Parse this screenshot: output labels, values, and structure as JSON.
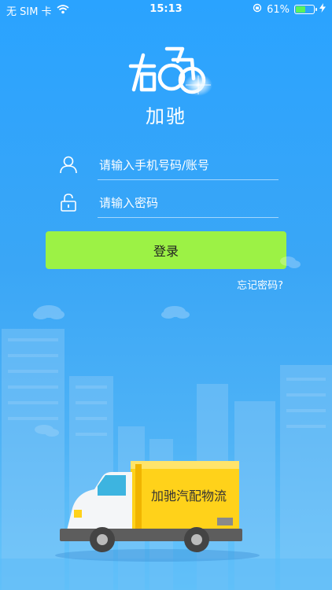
{
  "status_bar": {
    "carrier": "无 SIM 卡",
    "time": "15:13",
    "battery_percent": "61%",
    "battery_level": 0.61,
    "icons": [
      "wifi-icon",
      "orientation-lock-icon",
      "battery-icon",
      "charging-icon"
    ]
  },
  "app": {
    "name": "加驰"
  },
  "login": {
    "phone_placeholder": "请输入手机号码/账号",
    "password_placeholder": "请输入密码",
    "login_label": "登录",
    "forgot_label": "忘记密码?"
  },
  "illustration": {
    "truck_label": "加驰汽配物流"
  },
  "colors": {
    "background": "#2aa3ff",
    "login_button": "#9cf245",
    "truck_box": "#ffd21a"
  }
}
